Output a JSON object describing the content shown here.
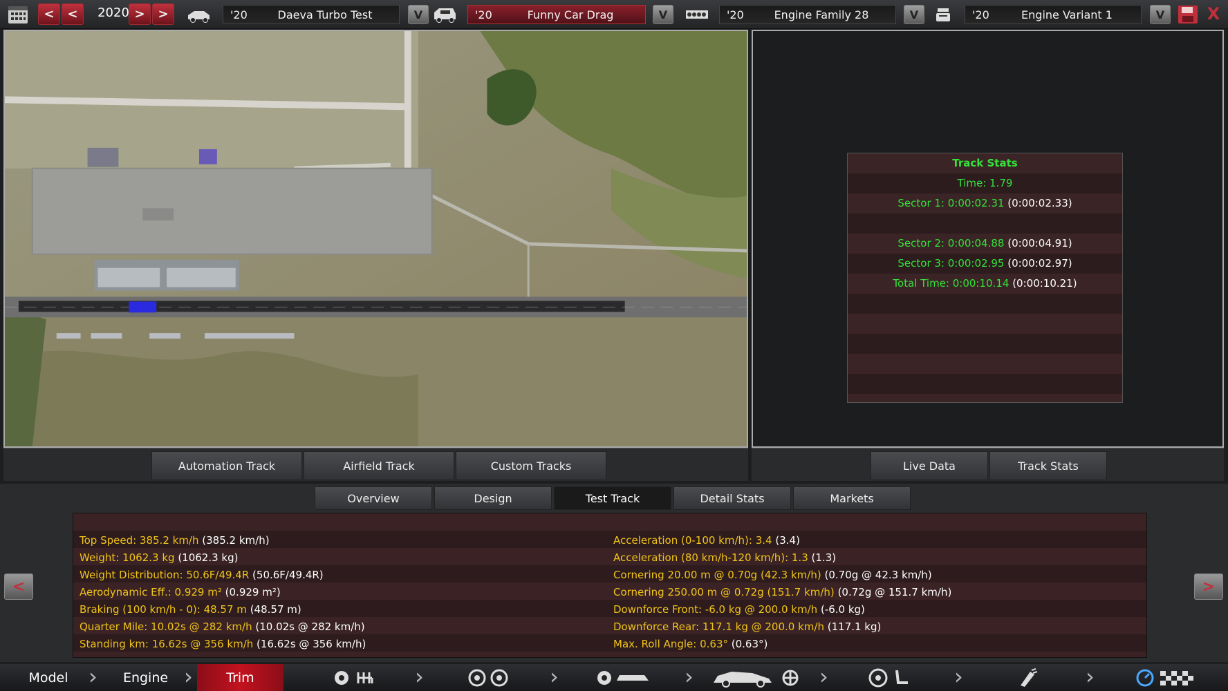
{
  "topbar": {
    "year": "2020",
    "model": {
      "year": "'20",
      "name": "Daeva Turbo Test"
    },
    "trim": {
      "year": "'20",
      "name": "Funny Car Drag"
    },
    "engine_family": {
      "year": "'20",
      "name": "Engine Family 28"
    },
    "engine_variant": {
      "year": "'20",
      "name": "Engine Variant 1"
    },
    "prev_prev": "<",
    "prev": "<",
    "next": ">",
    "next_next": ">",
    "dropdown": "V",
    "close": "X"
  },
  "track_buttons": [
    "Automation Track",
    "Airfield Track",
    "Custom Tracks"
  ],
  "right_buttons": [
    "Live Data",
    "Track Stats"
  ],
  "track_stats": {
    "title": "Track Stats",
    "time": "Time: 1.79",
    "rows": [
      {
        "label": "Sector 1: 0:00:02.31",
        "ref": "(0:00:02.33)"
      },
      {
        "label": "",
        "ref": ""
      },
      {
        "label": "Sector 2: 0:00:04.88",
        "ref": "(0:00:04.91)"
      },
      {
        "label": "Sector 3: 0:00:02.95",
        "ref": "(0:00:02.97)"
      },
      {
        "label": "Total Time: 0:00:10.14",
        "ref": "(0:00:10.21)"
      }
    ]
  },
  "main_tabs": [
    "Overview",
    "Design",
    "Test Track",
    "Detail Stats",
    "Markets"
  ],
  "active_tab": "Test Track",
  "stats_left": [
    {
      "label": "Top Speed: 385.2 km/h",
      "ref": "(385.2 km/h)"
    },
    {
      "label": "Weight: 1062.3 kg",
      "ref": "(1062.3 kg)"
    },
    {
      "label": "Weight Distribution: 50.6F/49.4R",
      "ref": "(50.6F/49.4R)"
    },
    {
      "label": "Aerodynamic Eff.: 0.929 m²",
      "ref": "(0.929 m²)"
    },
    {
      "label": "Braking (100 km/h - 0): 48.57 m",
      "ref": "(48.57 m)"
    },
    {
      "label": "Quarter Mile: 10.02s @ 282 km/h",
      "ref": "(10.02s @ 282 km/h)"
    },
    {
      "label": "Standing km: 16.62s @ 356 km/h",
      "ref": "(16.62s @ 356 km/h)"
    }
  ],
  "stats_right": [
    {
      "label": "Acceleration (0-100 km/h): 3.4",
      "ref": "(3.4)"
    },
    {
      "label": "Acceleration (80 km/h-120 km/h): 1.3",
      "ref": "(1.3)"
    },
    {
      "label": "Cornering 20.00 m @ 0.70g (42.3 km/h)",
      "ref": "(0.70g @ 42.3 km/h)"
    },
    {
      "label": "Cornering 250.00 m @ 0.72g (151.7 km/h)",
      "ref": "(0.72g @ 151.7 km/h)"
    },
    {
      "label": "Downforce Front: -6.0 kg @ 200.0 km/h",
      "ref": "(-6.0 kg)"
    },
    {
      "label": "Downforce Rear: 117.1 kg @ 200.0 km/h",
      "ref": "(117.1 kg)"
    },
    {
      "label": "Max. Roll Angle: 0.63°",
      "ref": "(0.63°)"
    }
  ],
  "side_prev": "<",
  "side_next": ">",
  "footer": {
    "model": "Model",
    "engine": "Engine",
    "trim": "Trim"
  },
  "colors": {
    "accent_red": "#c2121f",
    "stat_yellow": "#f0c419",
    "stat_green": "#34e23a"
  }
}
